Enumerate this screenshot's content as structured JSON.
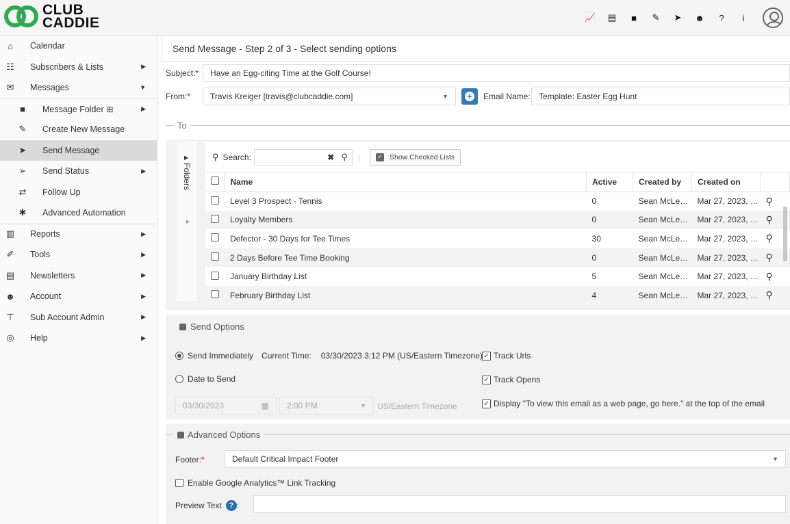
{
  "brand": {
    "line1": "CLUB",
    "line2": "CADDIE"
  },
  "topbar": {
    "icons": [
      "chart-line-icon",
      "document-icon",
      "folder-icon",
      "edit-icon",
      "send-icon",
      "users-icon",
      "question-icon",
      "info-icon"
    ],
    "glyphs": [
      "📈",
      "▤",
      "■",
      "✎",
      "➤",
      "☻",
      "?",
      "i"
    ]
  },
  "sidebar": {
    "items": [
      {
        "label": "Calendar",
        "icon": "⌂"
      },
      {
        "label": "Subscribers & Lists",
        "icon": "☷"
      },
      {
        "label": "Messages",
        "icon": "✉"
      },
      {
        "label": "Message Folder ⊞",
        "icon": "■"
      },
      {
        "label": "Create New Message",
        "icon": "✎"
      },
      {
        "label": "Send Message",
        "icon": "➤"
      },
      {
        "label": "Send Status",
        "icon": "➢"
      },
      {
        "label": "Follow Up",
        "icon": "⇄"
      },
      {
        "label": "Advanced Automation",
        "icon": "✱"
      },
      {
        "label": "Reports",
        "icon": "▥"
      },
      {
        "label": "Tools",
        "icon": "✐"
      },
      {
        "label": "Newsletters",
        "icon": "▤"
      },
      {
        "label": "Account",
        "icon": "☻"
      },
      {
        "label": "Sub Account Admin",
        "icon": "⊤"
      },
      {
        "label": "Help",
        "icon": "◎"
      }
    ]
  },
  "page": {
    "title": "Send Message - Step 2 of 3 - Select sending options"
  },
  "form": {
    "subject_label": "Subject:",
    "subject_value": "Have an Egg-citing Time at the Golf Course!",
    "from_label": "From:",
    "from_value": "Travis Kreiger  [travis@clubcaddie.com]",
    "email_name_label": "Email Name:",
    "email_name_value": "Template: Easter Egg Hunt",
    "required_mark": "*"
  },
  "to": {
    "legend": "To",
    "folders_label": "Folders",
    "search_label": "Search:",
    "show_checked_label": "Show Checked Lists",
    "columns": [
      "Name",
      "Active",
      "Created by",
      "Created on"
    ],
    "rows": [
      {
        "name": "Level 3 Prospect - Tennis",
        "active": "0",
        "created_by": "Sean McLe…",
        "created_on": "Mar 27, 2023, …"
      },
      {
        "name": "Loyalty Members",
        "active": "0",
        "created_by": "Sean McLe…",
        "created_on": "Mar 27, 2023, …"
      },
      {
        "name": "Defector - 30 Days for Tee Times",
        "active": "30",
        "created_by": "Sean McLe…",
        "created_on": "Mar 27, 2023, …"
      },
      {
        "name": "2 Days Before Tee Time Booking",
        "active": "0",
        "created_by": "Sean McLe…",
        "created_on": "Mar 27, 2023, …"
      },
      {
        "name": "January Birthday List",
        "active": "5",
        "created_by": "Sean McLe…",
        "created_on": "Mar 27, 2023, …"
      },
      {
        "name": "February Birthday List",
        "active": "4",
        "created_by": "Sean McLe…",
        "created_on": "Mar 27, 2023, …"
      }
    ]
  },
  "send_options": {
    "legend": "Send Options",
    "send_immediately": "Send Immediately",
    "current_time_label": "Current Time:",
    "current_time_value": "03/30/2023 3:12 PM (US/Eastern Timezone)",
    "date_to_send": "Date to Send",
    "date_value": "03/30/2023",
    "time_value": "2:00 PM",
    "timezone": "US/Eastern Timezone",
    "track_urls": "Track Urls",
    "track_opens": "Track Opens",
    "display_webpage": "Display \"To view this email as a web page, go here.\" at the top of the email"
  },
  "advanced_options": {
    "legend": "Advanced Options",
    "footer_label": "Footer:",
    "footer_value": "Default Critical Impact Footer",
    "ga_tracking": "Enable Google Analytics™ Link Tracking",
    "preview_text_label": "Preview Text",
    "preview_text_value": ""
  }
}
